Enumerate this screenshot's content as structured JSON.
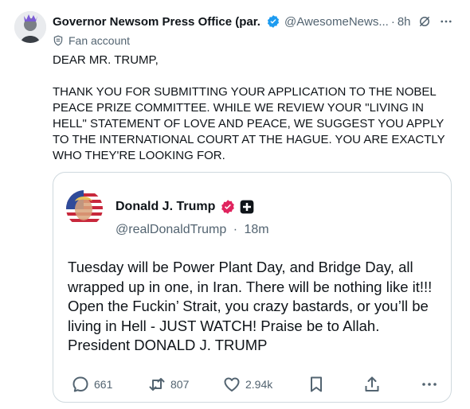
{
  "post": {
    "author_name": "Governor Newsom Press Office (par...",
    "handle": "@AwesomeNews...",
    "separator": "·",
    "time": "8h",
    "fan_label": "Fan account",
    "text": "DEAR MR. TRUMP,\n\nTHANK YOU FOR SUBMITTING YOUR APPLICATION TO THE NOBEL PEACE PRIZE COMMITTEE. WHILE WE REVIEW YOUR \"LIVING IN HELL\" STATEMENT OF LOVE AND PEACE, WE SUGGEST YOU APPLY TO THE INTERNATIONAL COURT AT THE HAGUE. YOU ARE EXACTLY WHO THEY'RE LOOKING FOR."
  },
  "quote": {
    "author_name": "Donald J. Trump",
    "handle": "@realDonaldTrump",
    "separator": "·",
    "time": "18m",
    "text": "Tuesday will be Power Plant Day, and Bridge Day, all wrapped up in one, in Iran. There will be nothing like it!!! Open the Fuckin’ Strait, you crazy bastards, or you’ll be living in Hell - JUST WATCH! Praise be to Allah. President DONALD J. TRUMP",
    "actions": {
      "replies": "661",
      "reposts": "807",
      "likes": "2.94k"
    }
  },
  "colors": {
    "text_primary": "#0f1419",
    "text_secondary": "#536471",
    "verified_blue": "#1d9bf0",
    "affiliate_pink": "#e0245e",
    "border": "#cfd9de"
  },
  "icons": {
    "verified": "verified-badge-icon",
    "grok": "grok-icon",
    "more": "more-icon",
    "fan": "shield-icon",
    "reply": "reply-icon",
    "repost": "repost-icon",
    "like": "heart-icon",
    "bookmark": "bookmark-icon",
    "share": "share-icon"
  }
}
